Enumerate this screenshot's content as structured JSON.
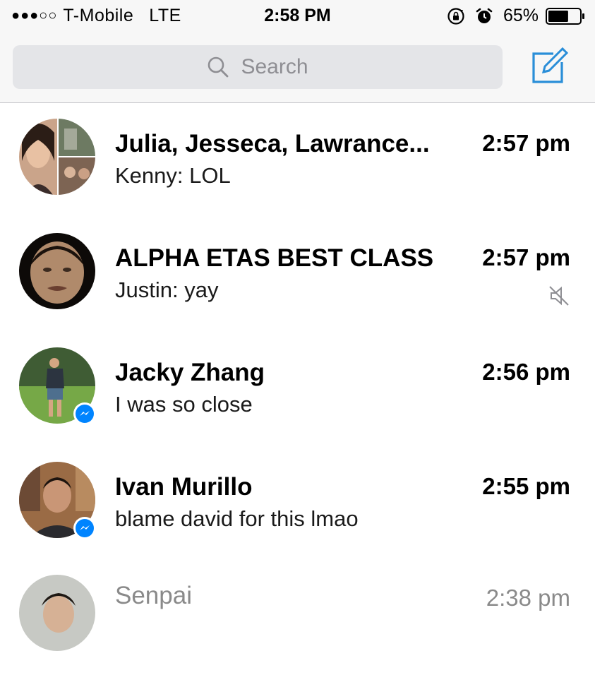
{
  "status_bar": {
    "signal": "●●●○○",
    "carrier": "T-Mobile",
    "network": "LTE",
    "time": "2:58 PM",
    "battery_percent": "65%",
    "battery_level": 0.65,
    "icons": [
      "rotation-lock-icon",
      "alarm-icon",
      "battery-icon"
    ]
  },
  "header": {
    "search_placeholder": "Search",
    "compose_icon": "compose-icon"
  },
  "conversations": [
    {
      "name": "Julia, Jesseca, Lawrance...",
      "snippet": "Kenny: LOL",
      "time": "2:57 pm",
      "muted": false,
      "messenger_badge": false,
      "avatar": "group-avatar"
    },
    {
      "name": "ALPHA ETAS BEST CLASS",
      "snippet": "Justin: yay",
      "time": "2:57 pm",
      "muted": true,
      "messenger_badge": false,
      "avatar": "group-avatar"
    },
    {
      "name": "Jacky Zhang",
      "snippet": "I was so close",
      "time": "2:56 pm",
      "muted": false,
      "messenger_badge": true,
      "avatar": "user-avatar"
    },
    {
      "name": "Ivan Murillo",
      "snippet": "blame david for this lmao",
      "time": "2:55 pm",
      "muted": false,
      "messenger_badge": true,
      "avatar": "user-avatar"
    },
    {
      "name": "Senpai",
      "snippet": "",
      "time": "2:38 pm",
      "muted": false,
      "messenger_badge": false,
      "avatar": "user-avatar"
    }
  ],
  "colors": {
    "accent": "#0084ff",
    "compose": "#2a8ed8",
    "muted_gray": "#8e8e93",
    "search_bg": "#e4e5e8"
  }
}
